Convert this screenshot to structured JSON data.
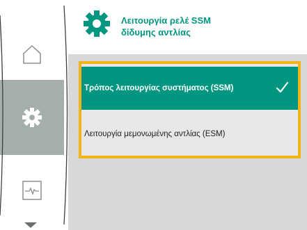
{
  "header": {
    "title_line1": "Λειτουργία ρελέ SSM",
    "title_line2": "δίδυμης αντλίας",
    "icon": "gear-icon"
  },
  "nav": {
    "items": [
      {
        "name": "home",
        "icon": "home-icon"
      },
      {
        "name": "settings",
        "icon": "gear-icon",
        "active": true
      },
      {
        "name": "monitor",
        "icon": "pulse-icon"
      }
    ],
    "more_icon": "scroll-down-arrow-icon"
  },
  "options": [
    {
      "label": "Τρόπος λειτουργίας συστήματος (SSM)",
      "selected": true
    },
    {
      "label": "Λειτουργία μεμονωμένης αντλίας (ESM)",
      "selected": false
    }
  ],
  "colors": {
    "accent": "#009680",
    "focus": "#f5b31a",
    "panel": "#d7d9d9",
    "active_rail": "#a4afaa"
  }
}
